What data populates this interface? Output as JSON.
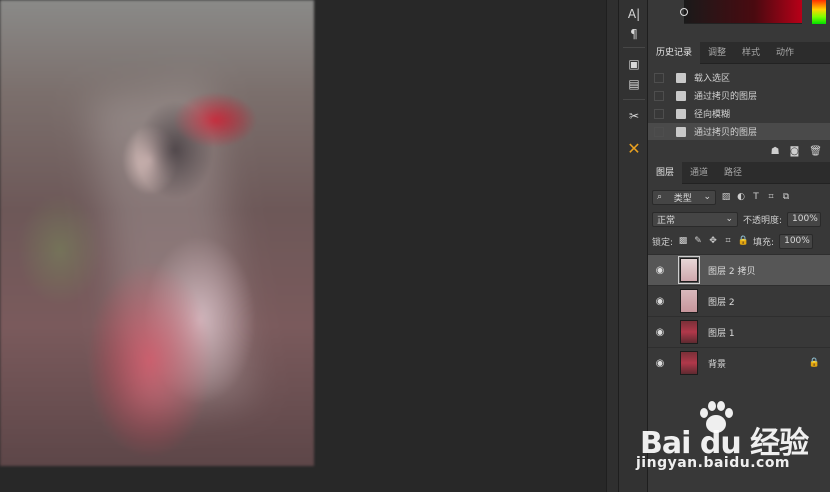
{
  "history": {
    "tabs": [
      "历史记录",
      "调整",
      "样式",
      "动作"
    ],
    "active_tab": 0,
    "items": [
      {
        "label": "载入选区",
        "selected": false
      },
      {
        "label": "通过拷贝的图层",
        "selected": false
      },
      {
        "label": "径向模糊",
        "selected": false
      },
      {
        "label": "通过拷贝的图层",
        "selected": true
      }
    ]
  },
  "layers": {
    "tabs": [
      "图层",
      "通道",
      "路径"
    ],
    "active_tab": 0,
    "filter_kind": "类型",
    "blend_mode": "正常",
    "opacity_label": "不透明度:",
    "opacity_value": "100%",
    "lock_label": "锁定:",
    "fill_label": "填充:",
    "fill_value": "100%",
    "items": [
      {
        "name": "图层 2 拷贝",
        "thumb": "light",
        "selected": true,
        "locked": false
      },
      {
        "name": "图层 2",
        "thumb": "pink",
        "selected": false,
        "locked": false
      },
      {
        "name": "图层 1",
        "thumb": "photo",
        "selected": false,
        "locked": false
      },
      {
        "name": "背景",
        "thumb": "photo",
        "selected": false,
        "locked": true
      }
    ]
  },
  "tools": [
    "character-icon",
    "paragraph-icon",
    "3d-icon",
    "notes-icon",
    "tools-icon",
    "brush-settings-icon"
  ],
  "watermark": {
    "logo_text": "Bai du 经验",
    "url": "jingyan.baidu.com"
  },
  "colors": {
    "panel_bg": "#383838",
    "workspace_bg": "#282828",
    "selected_row": "#565656",
    "accent_orange": "#e8a020"
  }
}
